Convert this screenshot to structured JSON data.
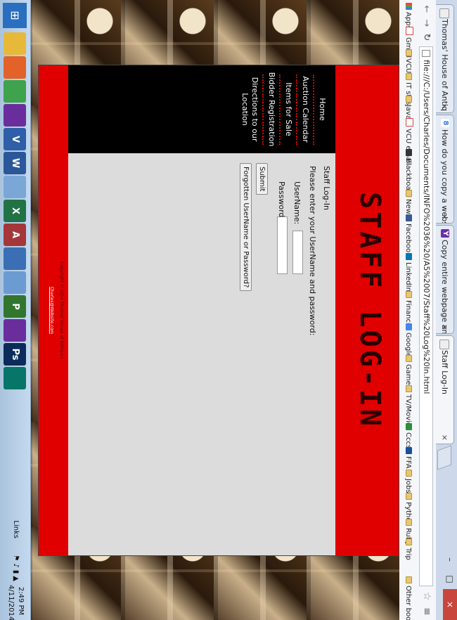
{
  "browser": {
    "tabs": [
      {
        "title": "Thomas' House of Antiq",
        "icon": "page-icon",
        "active": false
      },
      {
        "title": "How do you copy a webs",
        "icon": "google-icon",
        "active": false
      },
      {
        "title": "Copy entire webpage an",
        "icon": "yahoo-icon",
        "active": false
      },
      {
        "title": "Staff Log-In",
        "icon": "page-icon",
        "active": true
      }
    ],
    "tab_close": "×",
    "url": "file:///C:/Users/Charles/Documents/INFO%2036%20/A5%2007/Staff%20Log%20In.html",
    "window_buttons": {
      "minimize": "–",
      "maximize": "□",
      "close": "×"
    }
  },
  "bookmarks": [
    {
      "label": "Apps",
      "icon": "apps-icon"
    },
    {
      "label": "Gmail",
      "icon": "gmail-icon"
    },
    {
      "label": "VCUIT",
      "icon": "folder-icon"
    },
    {
      "label": "IT stes",
      "icon": "folder-icon"
    },
    {
      "label": "Java",
      "icon": "folder-icon"
    },
    {
      "label": "VCU email",
      "icon": "gmail-icon"
    },
    {
      "label": "Blackboard",
      "icon": "blackboard-icon"
    },
    {
      "label": "News",
      "icon": "folder-icon"
    },
    {
      "label": "Facebook",
      "icon": "facebook-icon"
    },
    {
      "label": "LinkedIn",
      "icon": "linkedin-icon"
    },
    {
      "label": "Finance",
      "icon": "folder-icon"
    },
    {
      "label": "Google",
      "icon": "google-icon"
    },
    {
      "label": "Games",
      "icon": "folder-icon"
    },
    {
      "label": "TV/Movies",
      "icon": "folder-icon"
    },
    {
      "label": "Cccs",
      "icon": "cccs-icon"
    },
    {
      "label": "FFA",
      "icon": "ffa-icon"
    },
    {
      "label": "Jobs",
      "icon": "folder-icon"
    },
    {
      "label": "Python",
      "icon": "folder-icon"
    },
    {
      "label": "Ruby",
      "icon": "folder-icon"
    },
    {
      "label": "Trip",
      "icon": "folder-icon"
    }
  ],
  "other_bookmarks": "Other bookmarks",
  "site": {
    "title": "STAFF LOG-IN",
    "nav": [
      "Home",
      "Auction Calendar",
      "Items for Sale",
      "Bidder Registration",
      "Directions to our Location"
    ],
    "form": {
      "heading": "Staff Log-In",
      "instructions": "Please enter your UserName and password:",
      "username_label": "UserName:",
      "password_label": "Password",
      "username_value": "",
      "password_value": "",
      "submit": "Submit",
      "forgot": "Forgotten UserName or Password?"
    },
    "footer": {
      "copyright": "Copyright © 2014 Thomas' House of Antiques",
      "email": "Charles@Website.com"
    }
  },
  "taskbar": {
    "apps": [
      {
        "icon": "explorer-folder-icon",
        "label": ""
      },
      {
        "icon": "firefox-icon",
        "label": ""
      },
      {
        "icon": "chrome-icon",
        "label": ""
      },
      {
        "icon": "visual-studio-icon",
        "label": ""
      },
      {
        "icon": "visio-icon",
        "label": "V"
      },
      {
        "icon": "word-icon",
        "label": "W"
      },
      {
        "icon": "notepad-icon",
        "label": ""
      },
      {
        "icon": "excel-icon",
        "label": "X"
      },
      {
        "icon": "access-icon",
        "label": "A"
      },
      {
        "icon": "hex-app-icon",
        "label": ""
      },
      {
        "icon": "paint-icon",
        "label": ""
      },
      {
        "icon": "project-icon",
        "label": "P"
      },
      {
        "icon": "visual-studio-icon",
        "label": ""
      },
      {
        "icon": "photoshop-icon",
        "label": "Ps"
      },
      {
        "icon": "publisher-icon",
        "label": ""
      }
    ],
    "links": "Links",
    "time": "2:49 PM",
    "date": "4/11/2014"
  },
  "colors": {
    "site_red": "#e00000",
    "sidebar_black": "#000000",
    "form_gray": "#dcdcdc"
  }
}
